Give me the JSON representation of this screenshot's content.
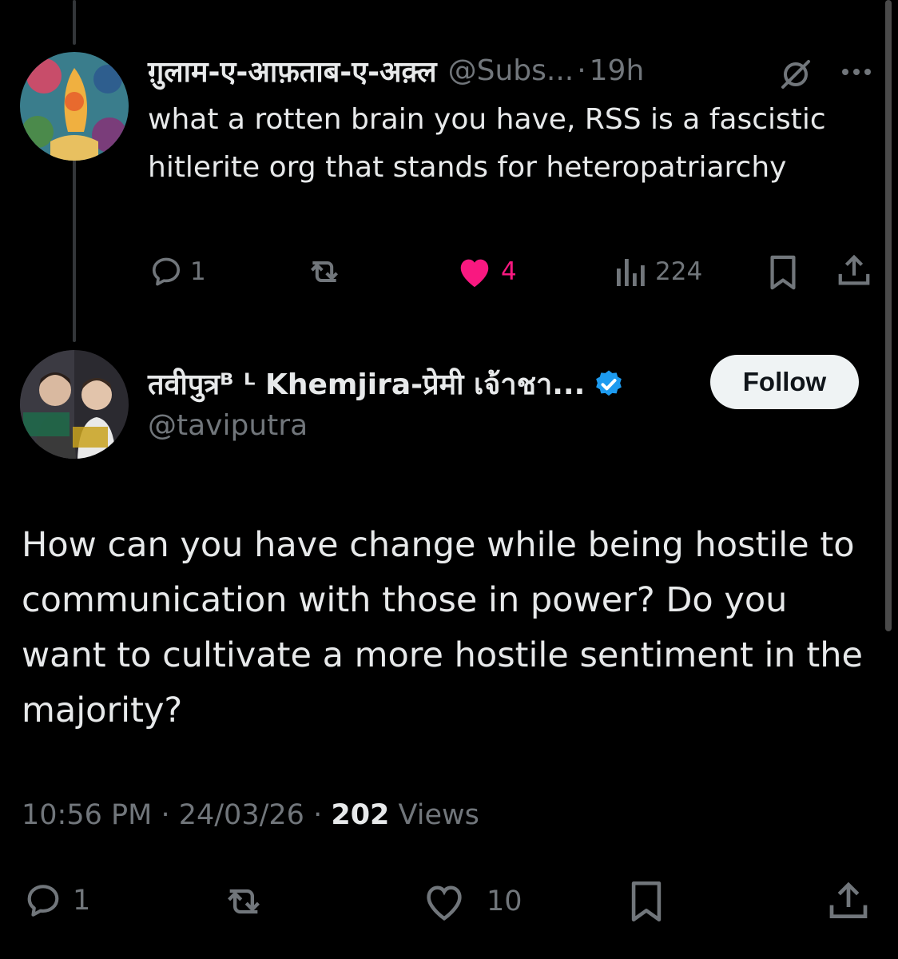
{
  "reply": {
    "display_name": "ग़ुलाम-ए-आफ़ताब-ए-अक़्ल",
    "handle": "@Subs...",
    "separator": "·",
    "time": "19h",
    "text": "what a rotten brain you have, RSS is a fascistic hitlerite org that stands for heteropatriarchy",
    "replies": "1",
    "likes": "4",
    "views": "224",
    "like_color": "#f91880"
  },
  "main": {
    "display_name": "तवीपुत्रᴮ ᴸ Khemjira-प्रेमी เจ้าชา...",
    "handle": "@taviputra",
    "follow_label": "Follow",
    "text": "How can you have change while being hostile to communication with those in power? Do you want to cultivate a more hostile sentiment in the majority?",
    "time": "10:56 PM",
    "date": "24/03/26",
    "separator": "·",
    "views_count": "202",
    "views_label": "Views",
    "replies": "1",
    "likes": "10",
    "verified_color": "#1d9bf0"
  }
}
